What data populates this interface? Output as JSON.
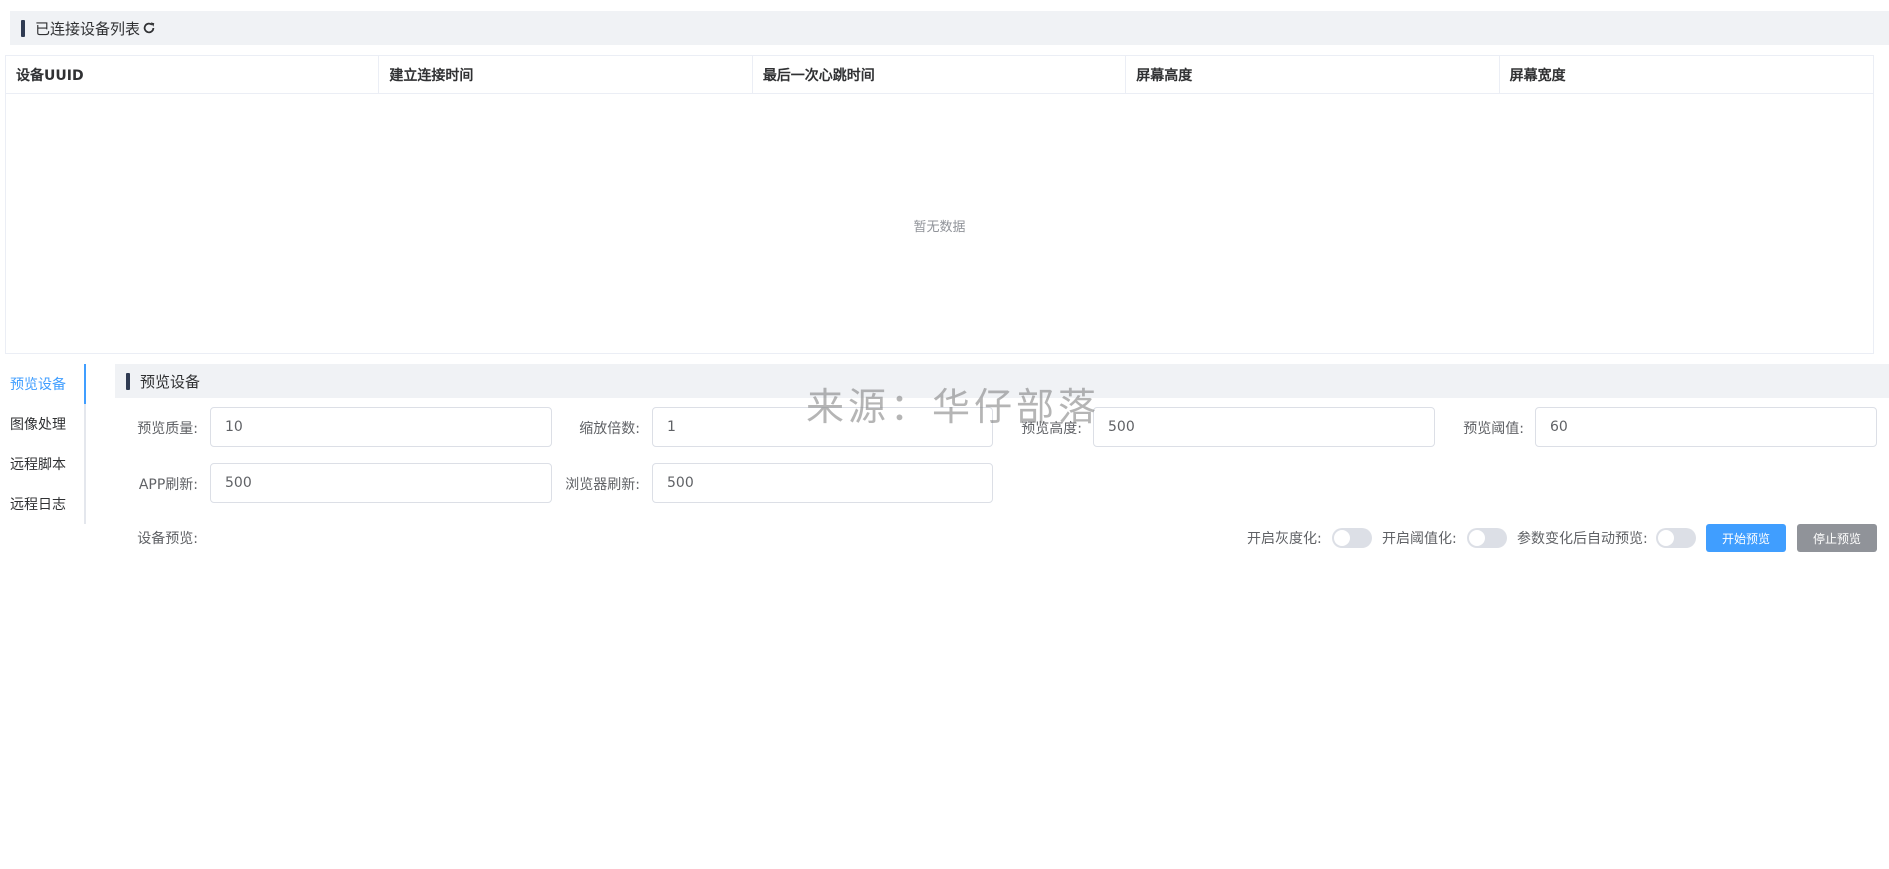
{
  "devices": {
    "title": "已连接设备列表",
    "refresh_icon": "refresh-icon",
    "columns": [
      "设备UUID",
      "建立连接时间",
      "最后一次心跳时间",
      "屏幕高度",
      "屏幕宽度"
    ],
    "empty_text": "暂无数据"
  },
  "side_tabs": [
    {
      "label": "预览设备",
      "active": true
    },
    {
      "label": "图像处理",
      "active": false
    },
    {
      "label": "远程脚本",
      "active": false
    },
    {
      "label": "远程日志",
      "active": false
    }
  ],
  "preview": {
    "title": "预览设备",
    "fields": {
      "quality": {
        "label": "预览质量:",
        "value": "10"
      },
      "scale": {
        "label": "缩放倍数:",
        "value": "1"
      },
      "height": {
        "label": "预览高度:",
        "value": "500"
      },
      "threshold": {
        "label": "预览阈值:",
        "value": "60"
      },
      "app_refresh": {
        "label": "APP刷新:",
        "value": "500"
      },
      "browser_refresh": {
        "label": "浏览器刷新:",
        "value": "500"
      }
    },
    "device_preview_label": "设备预览:",
    "switches": {
      "grayscale": {
        "label": "开启灰度化:",
        "on": false
      },
      "threshold": {
        "label": "开启阈值化:",
        "on": false
      },
      "auto_preview": {
        "label": "参数变化后自动预览:",
        "on": false
      }
    },
    "start_button": "开始预览",
    "stop_button": "停止预览"
  },
  "watermark": "来源：华仔部落",
  "colors": {
    "accent": "#409eff",
    "section_bg": "#f0f2f5",
    "stop_button": "#909399"
  }
}
